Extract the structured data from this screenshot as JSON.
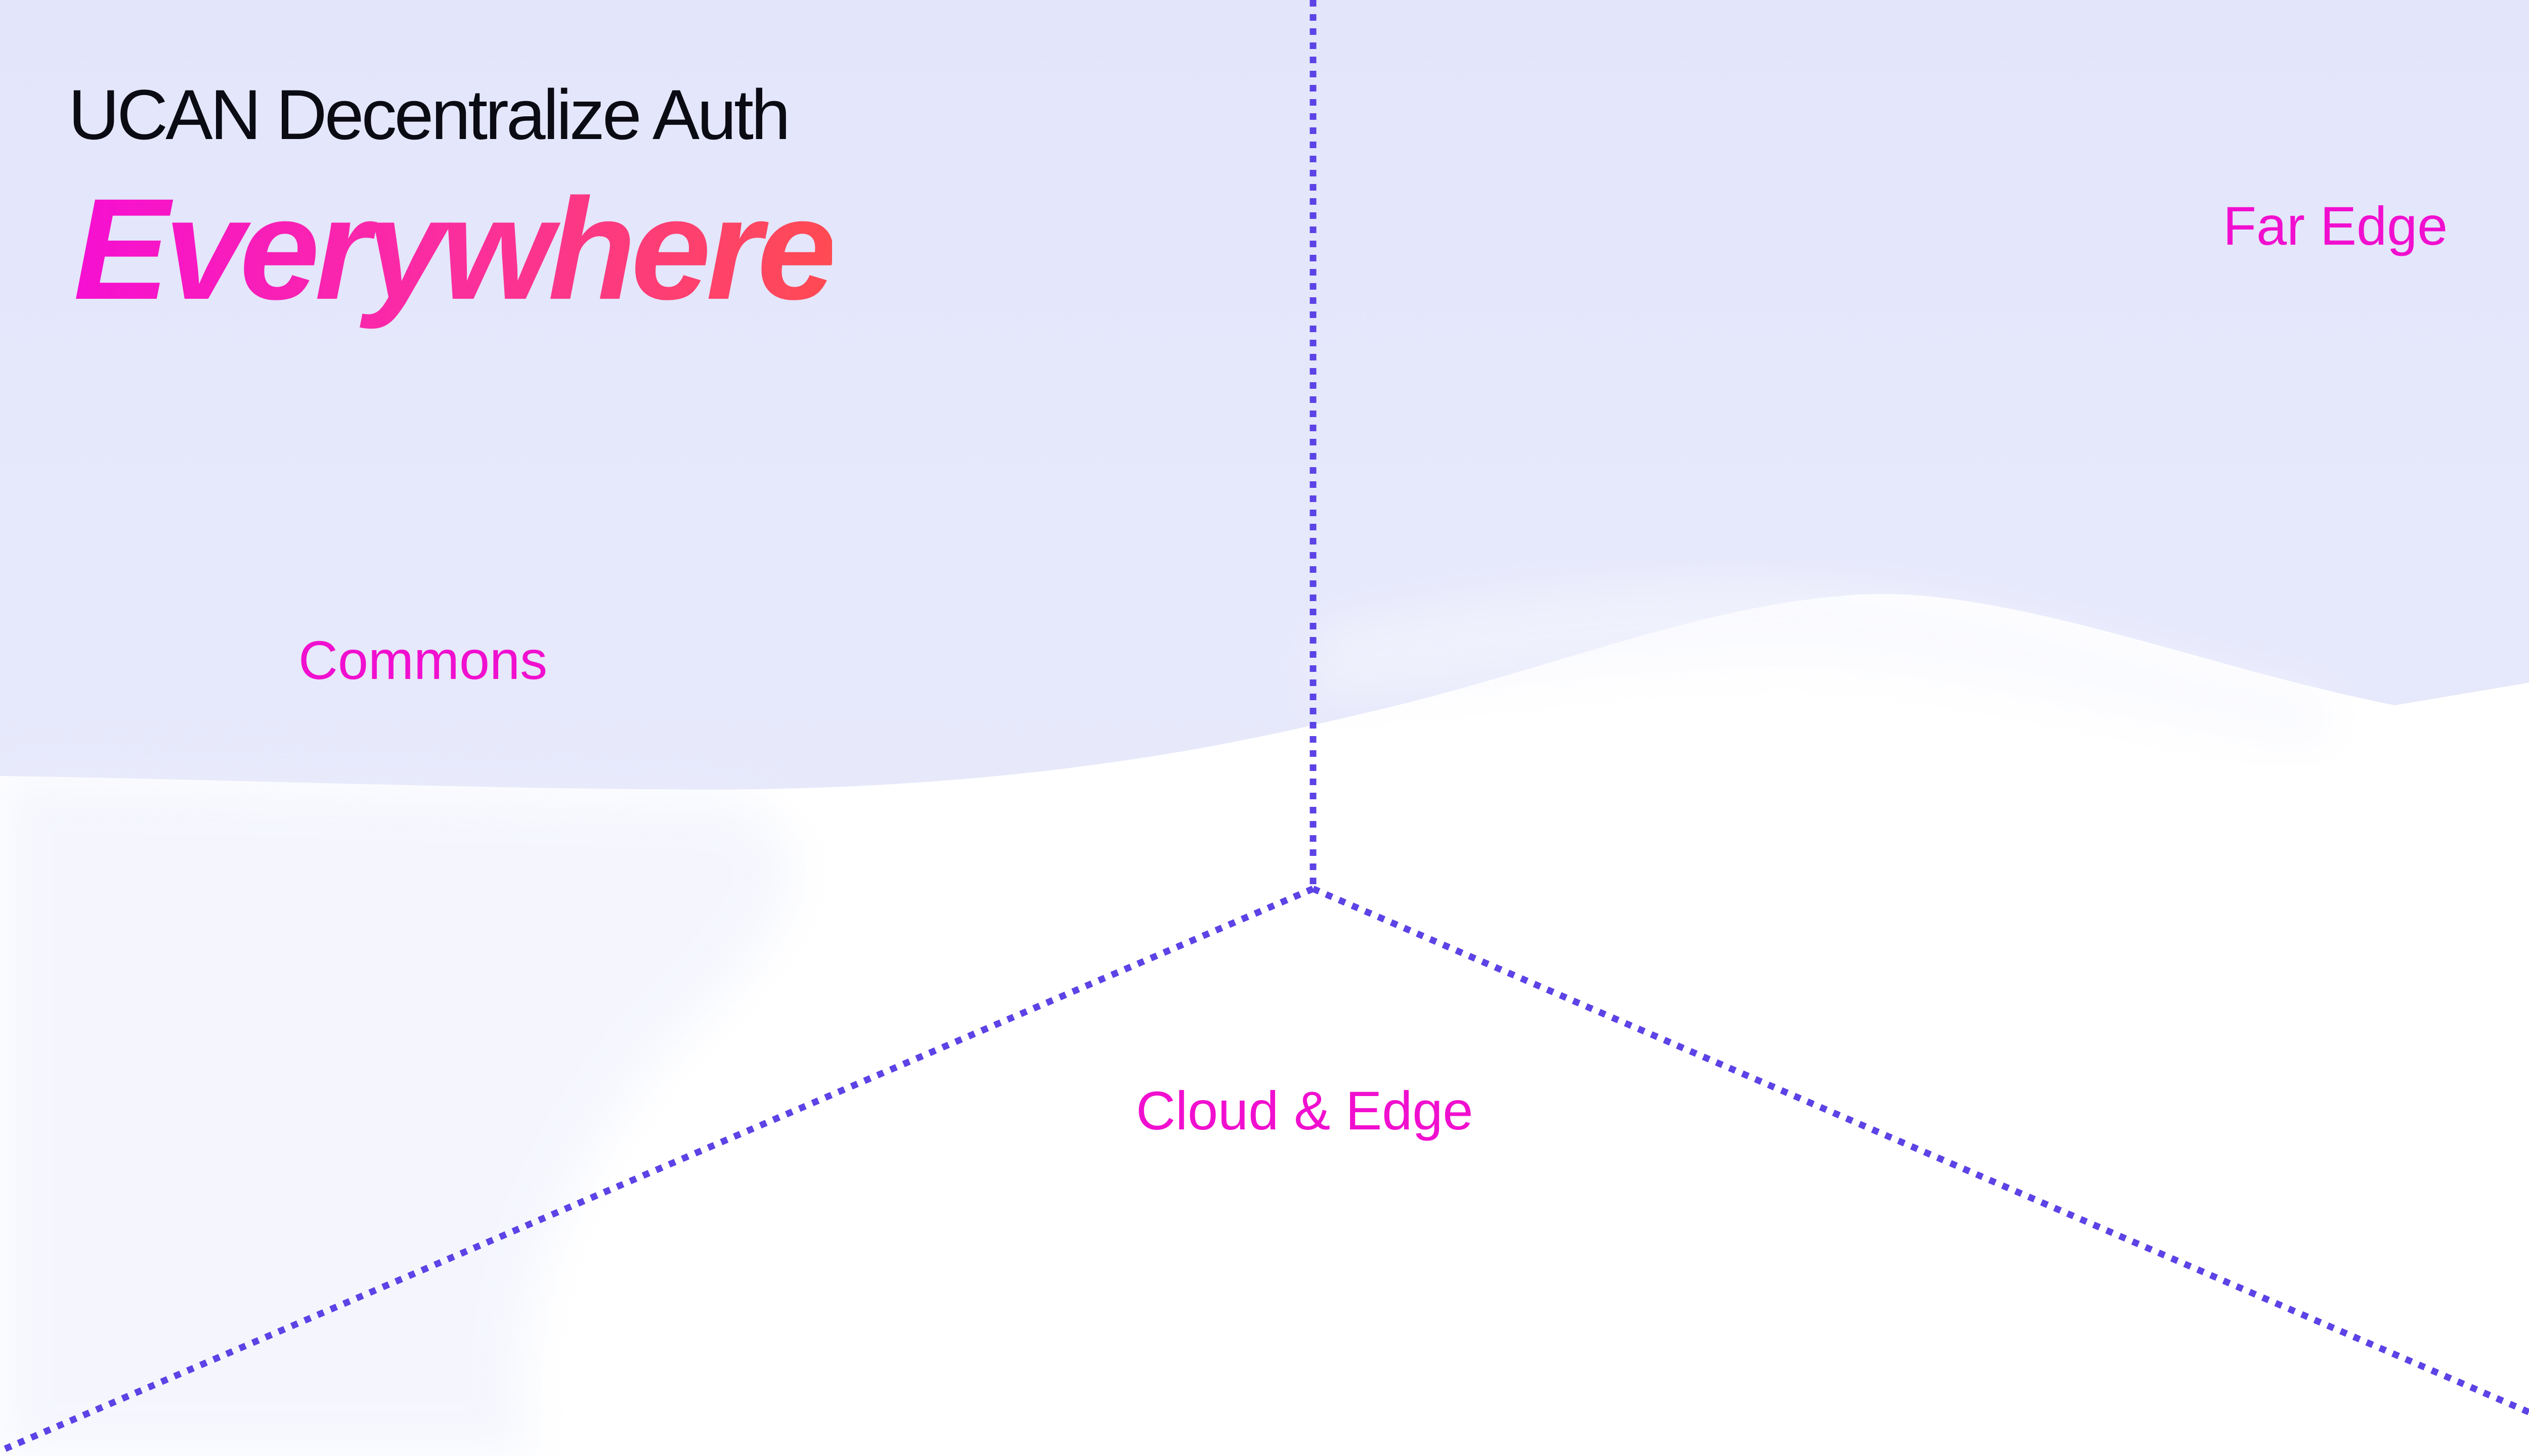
{
  "title": {
    "subtitle": "UCAN Decentralize Auth",
    "headline": "Everywhere"
  },
  "zones": {
    "commons": "Commons",
    "far_edge": "Far Edge",
    "cloud_edge": "Cloud & Edge"
  },
  "colors": {
    "background_tint": "#e4e6fb",
    "background_base": "#ffffff",
    "divider": "#5b43e6",
    "zone_label": "#f10fcf",
    "headline_gradient_start": "#f60fd2",
    "headline_gradient_end": "#ff4b52",
    "subtitle_text": "#0b0b14"
  }
}
